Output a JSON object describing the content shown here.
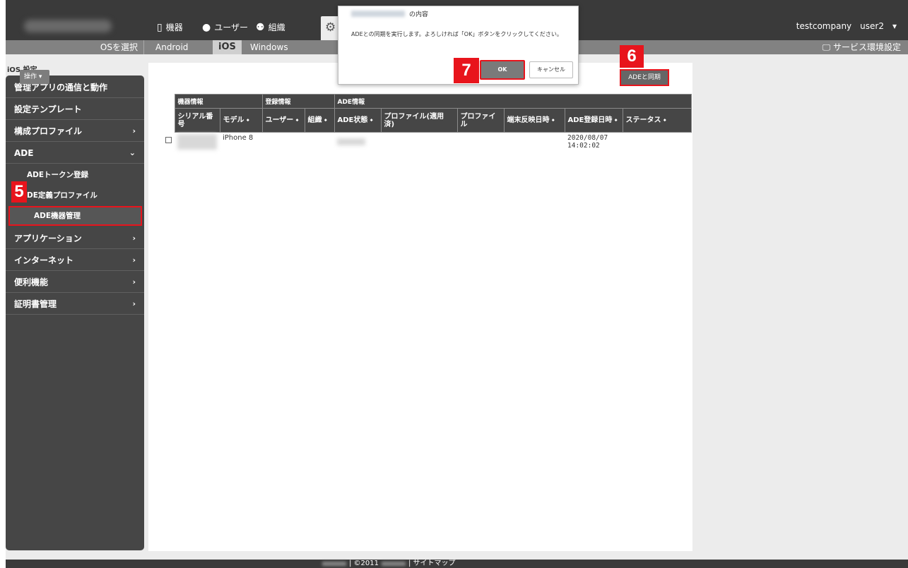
{
  "topbar": {
    "nav": [
      {
        "label": "機器",
        "icon": "device-icon"
      },
      {
        "label": "ユーザー",
        "icon": "user-icon"
      },
      {
        "label": "組織",
        "icon": "org-icon"
      }
    ],
    "company": "testcompany",
    "user": "user2"
  },
  "subbar": {
    "os_select": "OSを選択",
    "tabs": [
      "Android",
      "iOS",
      "Windows"
    ],
    "active_tab": "iOS",
    "service_env": "サービス環境設定"
  },
  "sidebar": {
    "title": "iOS 設定",
    "items": [
      {
        "label": "管理アプリの通信と動作"
      },
      {
        "label": "設定テンプレート"
      },
      {
        "label": "構成プロファイル",
        "chevron": "›"
      },
      {
        "label": "ADE",
        "chevron": "⌄"
      },
      {
        "label": "アプリケーション",
        "chevron": "›"
      },
      {
        "label": "インターネット",
        "chevron": "›"
      },
      {
        "label": "便利機能",
        "chevron": "›"
      },
      {
        "label": "証明書管理",
        "chevron": "›"
      }
    ],
    "ade_subitems": [
      "ADEトークン登録",
      "DE定義プロファイル",
      "ADE機器管理"
    ],
    "active_subitem": "ADE機器管理"
  },
  "main": {
    "ops_label": "操作 ▾",
    "ade_sync_label": "ADEと同期",
    "table": {
      "groups": [
        "機器情報",
        "登録情報",
        "ADE情報"
      ],
      "columns": [
        "シリアル番号",
        "モデル ⬩",
        "ユーザー ⬩",
        "組織 ⬩",
        "ADE状態 ⬩",
        "プロファイル(適用済)",
        "プロファイル",
        "端末反映日時 ⬩",
        "ADE登録日時 ⬩",
        "ステータス ⬩"
      ],
      "rows": [
        {
          "model": "iPhone 8",
          "registered": "2020/08/07\n14:02:02"
        }
      ]
    }
  },
  "dialog": {
    "title_suffix": "の内容",
    "message": "ADEとの同期を実行します。よろしければ「OK」ボタンをクリックしてください。",
    "ok": "OK",
    "cancel": "キャンセル"
  },
  "badges": {
    "step5": "5",
    "step6": "6",
    "step7": "7"
  },
  "footer": {
    "copyright": "| ©2011",
    "sitemap": "| サイトマップ"
  },
  "colors": {
    "dark": "#3a3a3a",
    "highlight": "#e8141c",
    "sidebar": "#464646"
  }
}
